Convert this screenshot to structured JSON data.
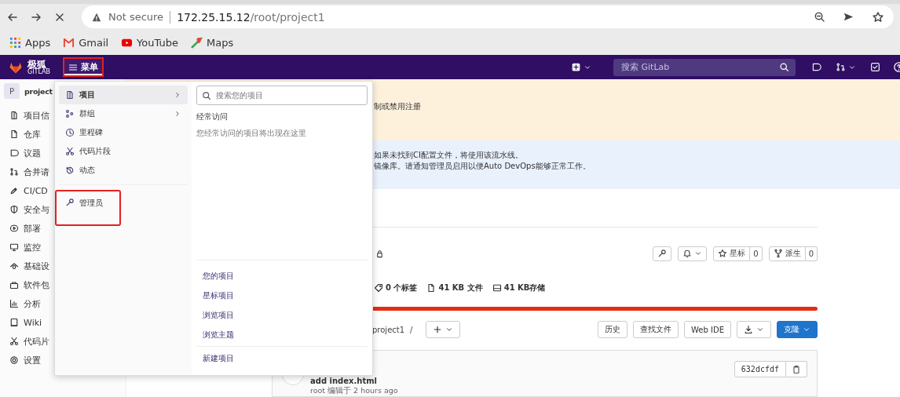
{
  "browser": {
    "security_label": "Not secure",
    "url_host": "172.25.15.12",
    "url_path": "/root/project1"
  },
  "bookmarks": [
    {
      "label": "Apps"
    },
    {
      "label": "Gmail"
    },
    {
      "label": "YouTube"
    },
    {
      "label": "Maps"
    }
  ],
  "header": {
    "logo_text": "极狐",
    "logo_subtext": "GITLAB",
    "menu_button": {
      "label": "菜单",
      "highlighted": true
    },
    "search": {
      "placeholder": "搜索 GitLab"
    }
  },
  "sidebar": {
    "avatar_letter": "P",
    "project_name": "project",
    "items": [
      {
        "label": "项目信"
      },
      {
        "label": "仓库"
      },
      {
        "label": "议题"
      },
      {
        "label": "合并请"
      },
      {
        "label": "CI/CD"
      },
      {
        "label": "安全与"
      },
      {
        "label": "部署"
      },
      {
        "label": "监控"
      },
      {
        "label": "基础设"
      },
      {
        "label": "软件包"
      },
      {
        "label": "分析"
      },
      {
        "label": "Wiki"
      },
      {
        "label": "代码片"
      },
      {
        "label": "设置"
      }
    ]
  },
  "banners": [
    {
      "kind": "warning",
      "lines": [
        "制或禁用注册"
      ]
    },
    {
      "kind": "info",
      "lines": [
        "如果未找到CI配置文件，将使用该流水线。",
        "镜像库。请通知管理员启用以便Auto DevOps能够正常工作。"
      ]
    }
  ],
  "project": {
    "star_button": {
      "label": "星标",
      "count": "0"
    },
    "fork_button": {
      "label": "派生",
      "count": "0"
    },
    "stats": [
      {
        "label": "0 个标签"
      },
      {
        "label": "41 KB 文件"
      },
      {
        "label": "41 KB存储"
      }
    ]
  },
  "toolbar": {
    "breadcrumb": "project1",
    "separator": "/",
    "buttons": [
      {
        "kind": "default",
        "label": "历史"
      },
      {
        "kind": "default",
        "label": "查找文件"
      },
      {
        "kind": "default",
        "label": "Web IDE"
      },
      {
        "kind": "download"
      },
      {
        "kind": "primary",
        "label": "克隆"
      }
    ]
  },
  "commit": {
    "title": "add index.html",
    "meta": "root 编辑于 2 hours ago",
    "sha": "632dcfdf"
  },
  "menu": {
    "items": [
      {
        "label": "项目",
        "selected": true,
        "submenu": true,
        "highlighted": false
      },
      {
        "label": "群组",
        "selected": false,
        "submenu": true,
        "highlighted": false
      },
      {
        "label": "里程碑",
        "selected": false,
        "submenu": false,
        "highlighted": false
      },
      {
        "label": "代码片段",
        "selected": false,
        "submenu": false,
        "highlighted": false
      },
      {
        "label": "动态",
        "selected": false,
        "submenu": false,
        "highlighted": false
      },
      {
        "label": "管理员",
        "selected": false,
        "submenu": false,
        "highlighted": true
      }
    ],
    "search": {
      "placeholder": "搜索您的项目"
    },
    "frequent_title": "经常访问",
    "frequent_empty": "您经常访问的项目将出现在这里",
    "links": [
      {
        "label": "您的项目"
      },
      {
        "label": "星标项目"
      },
      {
        "label": "浏览项目"
      },
      {
        "label": "浏览主题"
      }
    ],
    "new_link": "新建项目"
  }
}
